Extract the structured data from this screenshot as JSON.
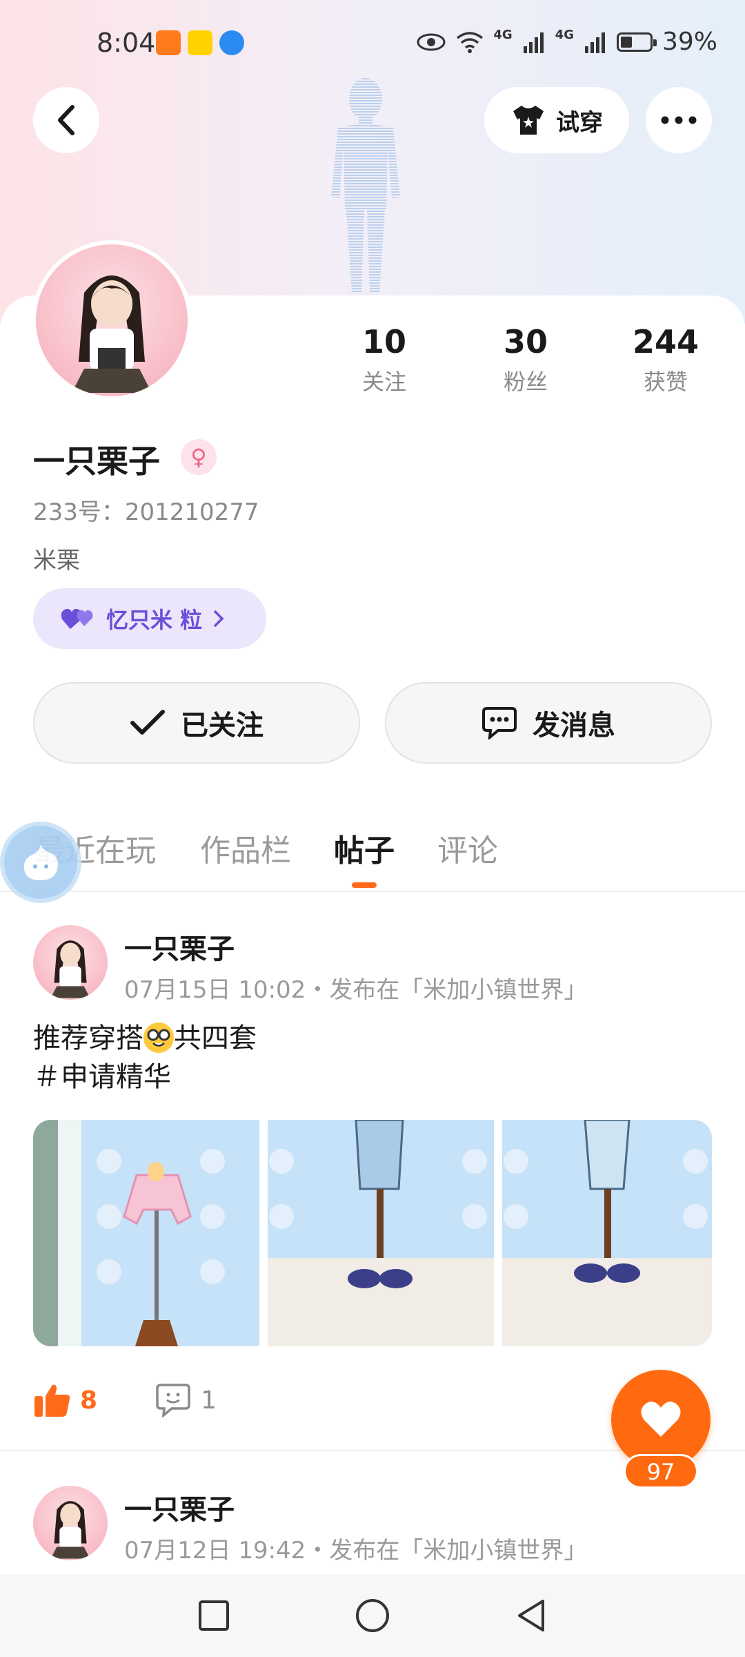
{
  "status_bar": {
    "time": "8:04",
    "network_1": "4G",
    "network_2": "4G",
    "battery_text": "39%",
    "battery_level": 0.39
  },
  "header": {
    "try_on_label": "试穿"
  },
  "profile": {
    "stats": [
      {
        "value": "10",
        "label": "关注"
      },
      {
        "value": "30",
        "label": "粉丝"
      },
      {
        "value": "244",
        "label": "获赞"
      }
    ],
    "name": "一只栗子",
    "gender_symbol": "♀",
    "id_text": "233号：201210277",
    "bio": "米栗",
    "tag_label": "忆只米 粒",
    "follow_label": "已关注",
    "message_label": "发消息"
  },
  "tabs": [
    {
      "label": "最近在玩",
      "active": false
    },
    {
      "label": "作品栏",
      "active": false
    },
    {
      "label": "帖子",
      "active": true
    },
    {
      "label": "评论",
      "active": false
    }
  ],
  "posts": [
    {
      "author": "一只栗子",
      "meta": "07月15日 10:02・发布在「米加小镇世界」",
      "text_line1_a": "推荐穿搭",
      "text_line1_b": "共四套",
      "text_line2": "＃申请精华",
      "likes": "8",
      "comments": "1"
    },
    {
      "author": "一只栗子",
      "meta": "07月12日 19:42・发布在「米加小镇世界」"
    }
  ],
  "fab": {
    "count": "97"
  },
  "colors": {
    "accent": "#ff6a10",
    "tag_bg": "#ebe6fb",
    "tag_text": "#6b4fd8",
    "gender_pink": "#f0638f"
  }
}
